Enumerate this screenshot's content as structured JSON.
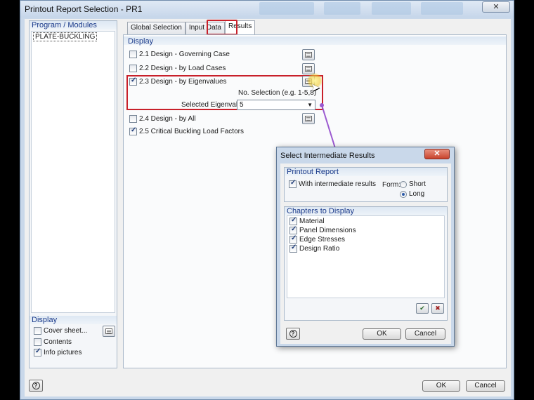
{
  "main": {
    "title": "Printout Report Selection - PR1",
    "close_glyph": "✕",
    "program_modules_label": "Program / Modules",
    "module_item": "PLATE-BUCKLING",
    "left_display": {
      "label": "Display",
      "items": [
        {
          "label": "Cover sheet...",
          "checked": false
        },
        {
          "label": "Contents",
          "checked": false
        },
        {
          "label": "Info pictures",
          "checked": true
        }
      ]
    },
    "tabs": [
      "Global Selection",
      "Input Data",
      "Results"
    ],
    "active_tab": "Results",
    "display_label": "Display",
    "results": [
      {
        "label": "2.1 Design - Governing Case",
        "checked": false
      },
      {
        "label": "2.2 Design - by Load Cases",
        "checked": false
      },
      {
        "label": "2.3 Design - by Eigenvalues",
        "checked": true
      },
      {
        "label": "2.4 Design - by All",
        "checked": false
      },
      {
        "label": "2.5 Critical Buckling Load Factors",
        "checked": true
      }
    ],
    "no_selection_label": "No. Selection (e.g. 1-5,8)",
    "selected_eigenvalue_label": "Selected Eigenvalue:",
    "selected_eigenvalue_value": "5",
    "help_glyph": "?",
    "ok_label": "OK",
    "cancel_label": "Cancel"
  },
  "sub_dialog": {
    "title": "Select Intermediate Results",
    "close_glyph": "✕",
    "printout_report_label": "Printout Report",
    "with_intermediate_label": "With intermediate results",
    "with_intermediate_checked": true,
    "form_label": "Form:",
    "form_options": [
      "Short",
      "Long"
    ],
    "form_selected": "Long",
    "chapters_label": "Chapters to Display",
    "chapters": [
      {
        "label": "Material",
        "checked": true
      },
      {
        "label": "Panel Dimensions",
        "checked": true
      },
      {
        "label": "Edge Stresses",
        "checked": true
      },
      {
        "label": "Design Ratio",
        "checked": true
      }
    ],
    "help_glyph": "?",
    "ok_label": "OK",
    "cancel_label": "Cancel"
  },
  "colors": {
    "highlight_red": "#c8202a",
    "arrow_purple": "#9b59d0",
    "group_label_blue": "#1a3a8a"
  }
}
